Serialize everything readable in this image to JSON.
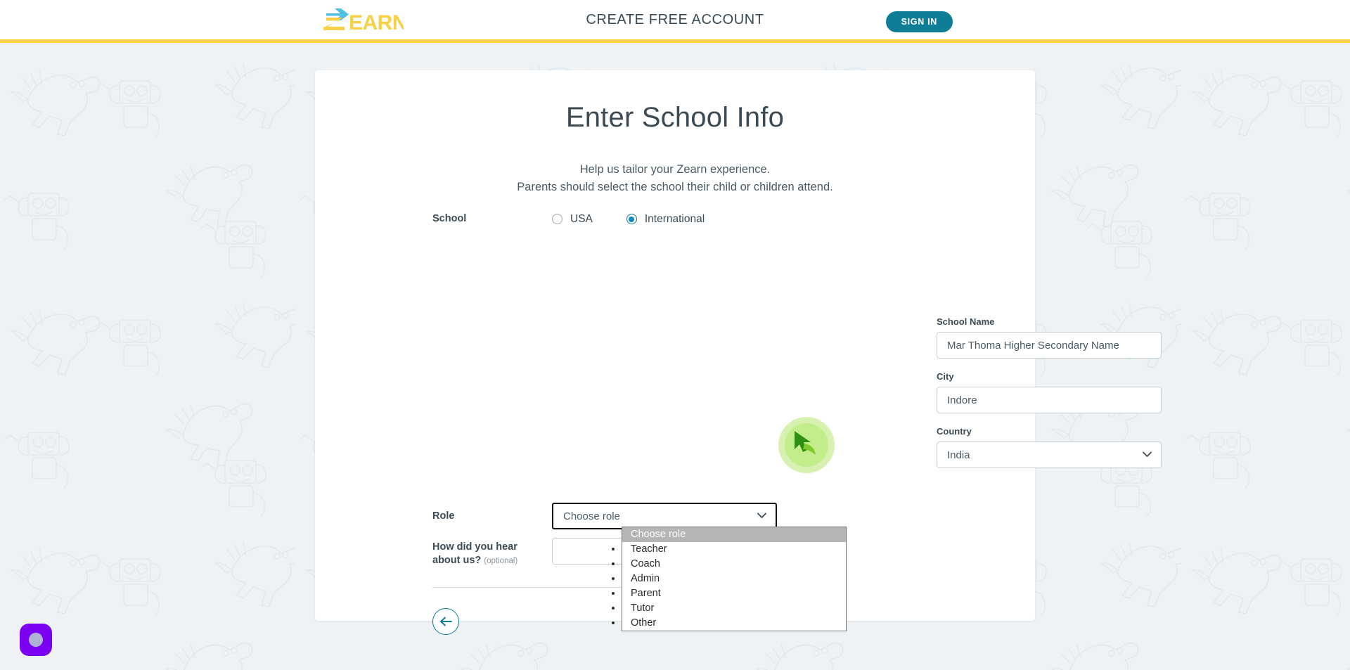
{
  "header": {
    "logo_text": "ZEARN",
    "logo_icon": "zearn-logo",
    "title": "CREATE FREE ACCOUNT",
    "signin_label": "SIGN IN",
    "accent_yellow": "#f7d046",
    "accent_teal": "#0d7e96",
    "logo_blue": "#4fbfe3",
    "logo_yellow": "#f7d046"
  },
  "page": {
    "title": "Enter School Info",
    "subtitle_1": "Help us tailor your Zearn experience.",
    "subtitle_2": "Parents should select the school their child or children attend."
  },
  "form": {
    "school": {
      "label": "School",
      "options": [
        {
          "label": "USA",
          "selected": false
        },
        {
          "label": "International",
          "selected": true
        }
      ]
    },
    "school_name": {
      "label": "School Name",
      "value": "Mar Thoma Higher Secondary Name",
      "placeholder": "School Name"
    },
    "city": {
      "label": "City",
      "value": "Indore",
      "placeholder": "City"
    },
    "country": {
      "label": "Country",
      "value": "India",
      "icon": "chevron-down-icon"
    },
    "role": {
      "label": "Role",
      "value": "Choose role",
      "icon": "chevron-down-icon",
      "focused": true,
      "options": [
        {
          "label": "Choose role",
          "selected": true
        },
        {
          "label": "Teacher",
          "selected": false
        },
        {
          "label": "Coach",
          "selected": false
        },
        {
          "label": "Admin",
          "selected": false
        },
        {
          "label": "Parent",
          "selected": false
        },
        {
          "label": "Tutor",
          "selected": false
        },
        {
          "label": "Other",
          "selected": false
        }
      ]
    },
    "hear_about": {
      "label_line_1": "How did you hear",
      "label_line_2": "about us?",
      "optional_tag": "(optional)",
      "value": "",
      "icon": "chevron-down-icon"
    },
    "back_button": {
      "icon": "arrow-left-icon",
      "label": ""
    }
  },
  "widgets": {
    "chat": {
      "icon": "chat-bubble-icon",
      "color": "#7c00f2"
    }
  }
}
